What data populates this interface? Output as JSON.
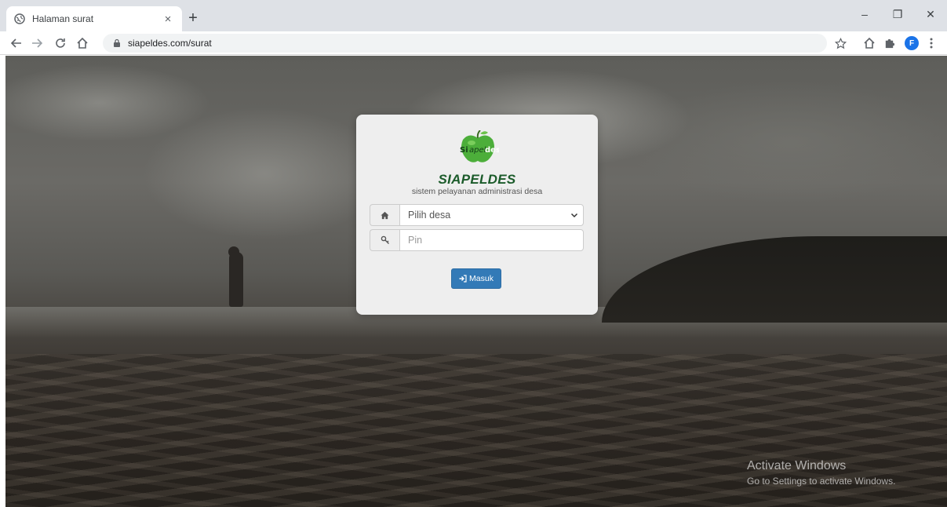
{
  "browser": {
    "tab_title": "Halaman surat",
    "tab_close": "×",
    "new_tab": "+",
    "url": "siapeldes.com/surat",
    "profile_initial": "F",
    "controls": {
      "minimize": "–",
      "restore": "❐",
      "close": "✕"
    }
  },
  "login": {
    "brand_name": "SIAPELDES",
    "tagline": "sistem pelayanan administrasi desa",
    "village_select": {
      "selected": "Pilih desa",
      "icon": "home-icon"
    },
    "pin_input": {
      "placeholder": "Pin",
      "icon": "key-icon"
    },
    "submit_label": "Masuk",
    "colors": {
      "brand_green": "#1b5b2a",
      "button_blue": "#337ab7",
      "card_bg": "#eeeeee"
    }
  },
  "watermark": {
    "title": "Activate Windows",
    "subtitle": "Go to Settings to activate Windows."
  }
}
